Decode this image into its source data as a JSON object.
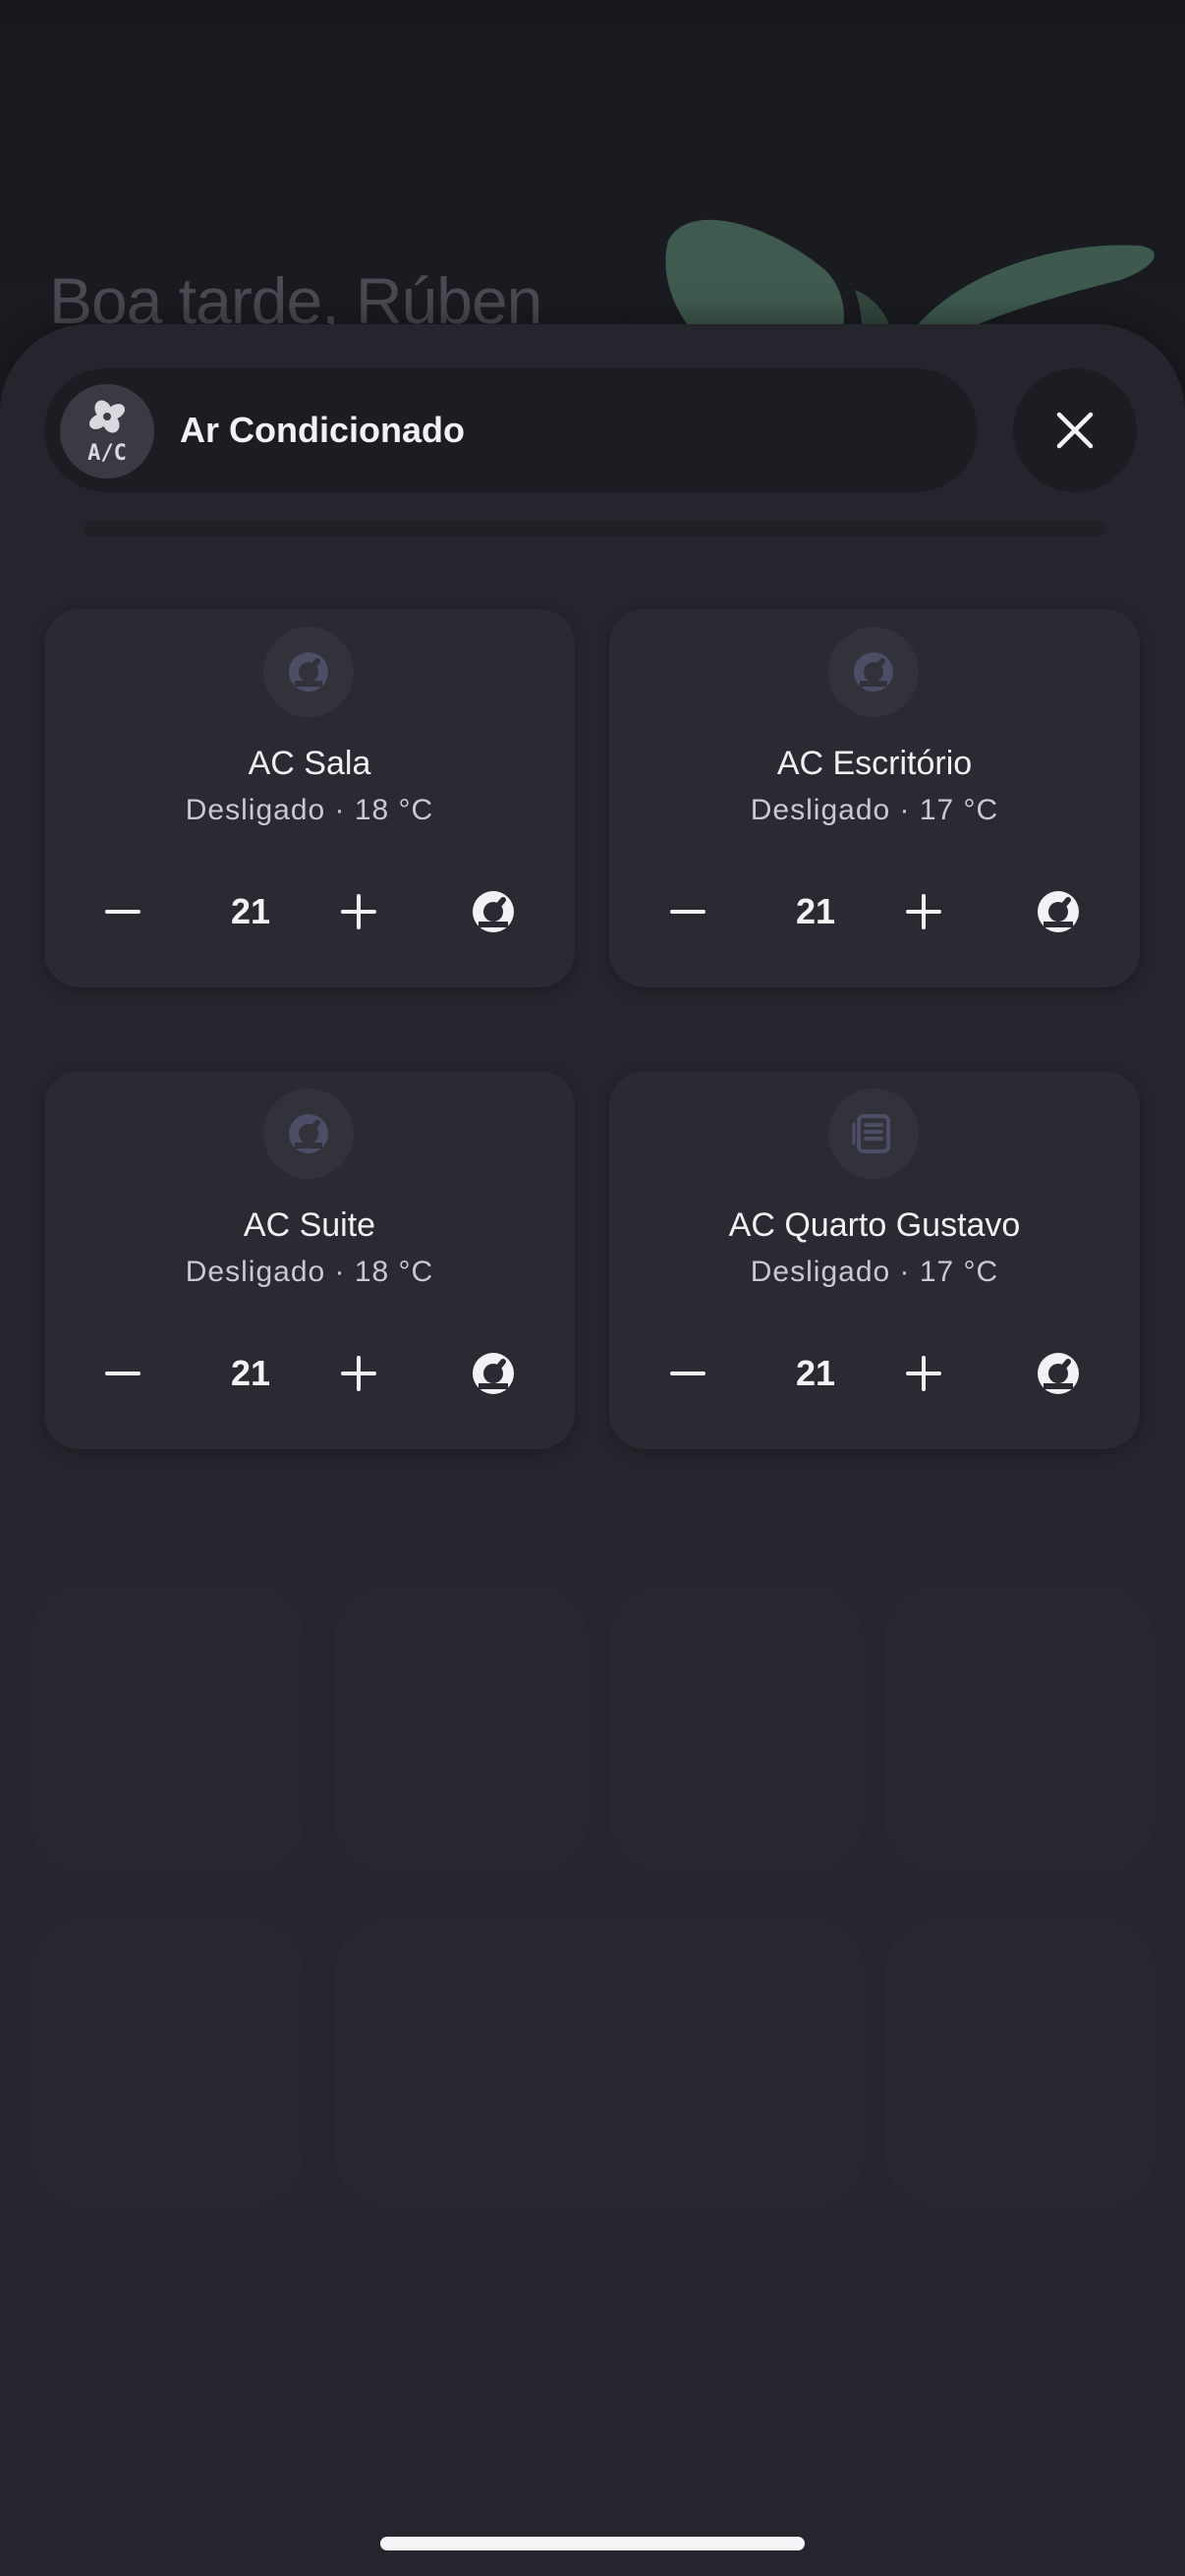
{
  "background": {
    "greeting": "Boa tarde, Rúben"
  },
  "sheet": {
    "header": {
      "title": "Ar Condicionado",
      "icon": "ac-fan-icon"
    },
    "close_icon": "close-icon"
  },
  "devices": [
    {
      "name": "AC Sala",
      "status": "Desligado · 18 °C",
      "setpoint": "21",
      "icon": "gauge-icon"
    },
    {
      "name": "AC Escritório",
      "status": "Desligado · 17 °C",
      "setpoint": "21",
      "icon": "gauge-icon"
    },
    {
      "name": "AC Suite",
      "status": "Desligado · 18 °C",
      "setpoint": "21",
      "icon": "gauge-icon"
    },
    {
      "name": "AC Quarto Gustavo",
      "status": "Desligado · 17 °C",
      "setpoint": "21",
      "icon": "heater-icon"
    }
  ],
  "colors": {
    "sheet": "#25262d",
    "card": "#2a2b32",
    "icon_muted": "#4b4e66",
    "text": "#f1f1f4"
  }
}
